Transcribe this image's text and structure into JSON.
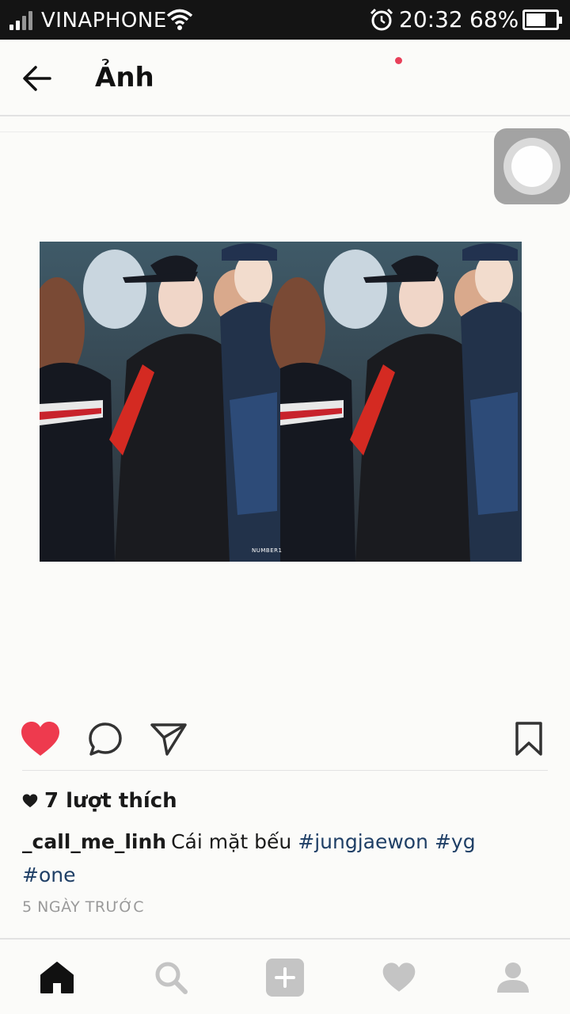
{
  "status_bar": {
    "carrier": "VINAPHONE",
    "time": "20:32",
    "battery_percent": "68%",
    "battery_level": 0.68,
    "icons": [
      "signal-icon",
      "wifi-icon",
      "alarm-icon",
      "battery-icon"
    ]
  },
  "header": {
    "title": "Ảnh",
    "back_icon": "arrow-left-icon"
  },
  "post": {
    "photo_watermark": "NUMBER1",
    "liked": true,
    "likes_text": "7 lượt thích",
    "username": "_call_me_linh",
    "caption_text": "Cái mặt bếu",
    "hashtags": [
      "#jungjaewon",
      "#yg",
      "#one"
    ],
    "time_ago": "5 NGÀY TRƯỚC"
  },
  "actions": {
    "like_icon": "heart-filled-icon",
    "comment_icon": "comment-icon",
    "share_icon": "send-icon",
    "save_icon": "bookmark-icon"
  },
  "bottom_nav": {
    "items": [
      "home-icon",
      "search-icon",
      "add-post-icon",
      "activity-icon",
      "profile-icon"
    ],
    "has_notification": true
  },
  "colors": {
    "status_bar_bg": "#141414",
    "like_red": "#ee3a4e",
    "hashtag_blue": "#1f3f66",
    "notification_dot": "#e8405a",
    "muted_gray": "#9a9a9a"
  }
}
